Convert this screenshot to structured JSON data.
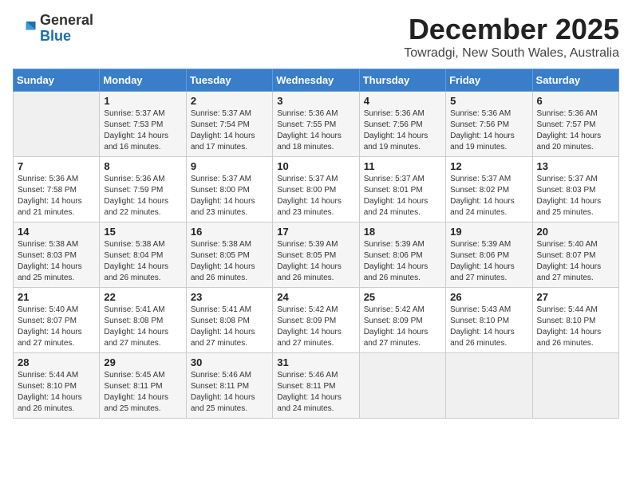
{
  "header": {
    "logo_general": "General",
    "logo_blue": "Blue",
    "month_title": "December 2025",
    "location": "Towradgi, New South Wales, Australia"
  },
  "weekdays": [
    "Sunday",
    "Monday",
    "Tuesday",
    "Wednesday",
    "Thursday",
    "Friday",
    "Saturday"
  ],
  "weeks": [
    [
      {
        "day": "",
        "info": ""
      },
      {
        "day": "1",
        "info": "Sunrise: 5:37 AM\nSunset: 7:53 PM\nDaylight: 14 hours\nand 16 minutes."
      },
      {
        "day": "2",
        "info": "Sunrise: 5:37 AM\nSunset: 7:54 PM\nDaylight: 14 hours\nand 17 minutes."
      },
      {
        "day": "3",
        "info": "Sunrise: 5:36 AM\nSunset: 7:55 PM\nDaylight: 14 hours\nand 18 minutes."
      },
      {
        "day": "4",
        "info": "Sunrise: 5:36 AM\nSunset: 7:56 PM\nDaylight: 14 hours\nand 19 minutes."
      },
      {
        "day": "5",
        "info": "Sunrise: 5:36 AM\nSunset: 7:56 PM\nDaylight: 14 hours\nand 19 minutes."
      },
      {
        "day": "6",
        "info": "Sunrise: 5:36 AM\nSunset: 7:57 PM\nDaylight: 14 hours\nand 20 minutes."
      }
    ],
    [
      {
        "day": "7",
        "info": "Sunrise: 5:36 AM\nSunset: 7:58 PM\nDaylight: 14 hours\nand 21 minutes."
      },
      {
        "day": "8",
        "info": "Sunrise: 5:36 AM\nSunset: 7:59 PM\nDaylight: 14 hours\nand 22 minutes."
      },
      {
        "day": "9",
        "info": "Sunrise: 5:37 AM\nSunset: 8:00 PM\nDaylight: 14 hours\nand 23 minutes."
      },
      {
        "day": "10",
        "info": "Sunrise: 5:37 AM\nSunset: 8:00 PM\nDaylight: 14 hours\nand 23 minutes."
      },
      {
        "day": "11",
        "info": "Sunrise: 5:37 AM\nSunset: 8:01 PM\nDaylight: 14 hours\nand 24 minutes."
      },
      {
        "day": "12",
        "info": "Sunrise: 5:37 AM\nSunset: 8:02 PM\nDaylight: 14 hours\nand 24 minutes."
      },
      {
        "day": "13",
        "info": "Sunrise: 5:37 AM\nSunset: 8:03 PM\nDaylight: 14 hours\nand 25 minutes."
      }
    ],
    [
      {
        "day": "14",
        "info": "Sunrise: 5:38 AM\nSunset: 8:03 PM\nDaylight: 14 hours\nand 25 minutes."
      },
      {
        "day": "15",
        "info": "Sunrise: 5:38 AM\nSunset: 8:04 PM\nDaylight: 14 hours\nand 26 minutes."
      },
      {
        "day": "16",
        "info": "Sunrise: 5:38 AM\nSunset: 8:05 PM\nDaylight: 14 hours\nand 26 minutes."
      },
      {
        "day": "17",
        "info": "Sunrise: 5:39 AM\nSunset: 8:05 PM\nDaylight: 14 hours\nand 26 minutes."
      },
      {
        "day": "18",
        "info": "Sunrise: 5:39 AM\nSunset: 8:06 PM\nDaylight: 14 hours\nand 26 minutes."
      },
      {
        "day": "19",
        "info": "Sunrise: 5:39 AM\nSunset: 8:06 PM\nDaylight: 14 hours\nand 27 minutes."
      },
      {
        "day": "20",
        "info": "Sunrise: 5:40 AM\nSunset: 8:07 PM\nDaylight: 14 hours\nand 27 minutes."
      }
    ],
    [
      {
        "day": "21",
        "info": "Sunrise: 5:40 AM\nSunset: 8:07 PM\nDaylight: 14 hours\nand 27 minutes."
      },
      {
        "day": "22",
        "info": "Sunrise: 5:41 AM\nSunset: 8:08 PM\nDaylight: 14 hours\nand 27 minutes."
      },
      {
        "day": "23",
        "info": "Sunrise: 5:41 AM\nSunset: 8:08 PM\nDaylight: 14 hours\nand 27 minutes."
      },
      {
        "day": "24",
        "info": "Sunrise: 5:42 AM\nSunset: 8:09 PM\nDaylight: 14 hours\nand 27 minutes."
      },
      {
        "day": "25",
        "info": "Sunrise: 5:42 AM\nSunset: 8:09 PM\nDaylight: 14 hours\nand 27 minutes."
      },
      {
        "day": "26",
        "info": "Sunrise: 5:43 AM\nSunset: 8:10 PM\nDaylight: 14 hours\nand 26 minutes."
      },
      {
        "day": "27",
        "info": "Sunrise: 5:44 AM\nSunset: 8:10 PM\nDaylight: 14 hours\nand 26 minutes."
      }
    ],
    [
      {
        "day": "28",
        "info": "Sunrise: 5:44 AM\nSunset: 8:10 PM\nDaylight: 14 hours\nand 26 minutes."
      },
      {
        "day": "29",
        "info": "Sunrise: 5:45 AM\nSunset: 8:11 PM\nDaylight: 14 hours\nand 25 minutes."
      },
      {
        "day": "30",
        "info": "Sunrise: 5:46 AM\nSunset: 8:11 PM\nDaylight: 14 hours\nand 25 minutes."
      },
      {
        "day": "31",
        "info": "Sunrise: 5:46 AM\nSunset: 8:11 PM\nDaylight: 14 hours\nand 24 minutes."
      },
      {
        "day": "",
        "info": ""
      },
      {
        "day": "",
        "info": ""
      },
      {
        "day": "",
        "info": ""
      }
    ]
  ]
}
